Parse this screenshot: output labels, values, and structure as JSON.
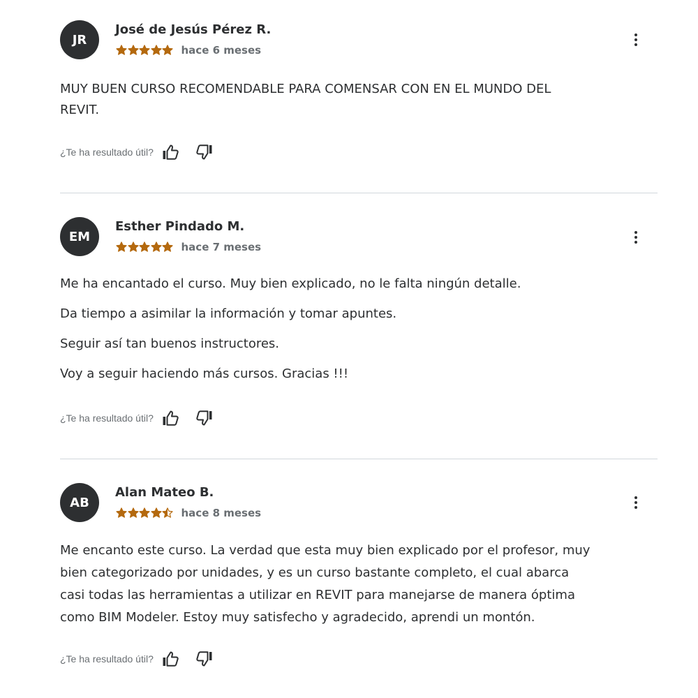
{
  "helpful_label": "¿Te ha resultado útil?",
  "colors": {
    "star": "#b4690e",
    "avatar_bg": "#2d2f31",
    "text": "#2d2f31",
    "muted": "#6a6f73",
    "divider": "#d1d7dc"
  },
  "reviews": [
    {
      "initials": "JR",
      "name": "José de Jesús Pérez R.",
      "rating": 5,
      "time": "hace 6 meses",
      "lines": [
        "MUY BUEN CURSO RECOMENDABLE PARA COMENSAR CON EN EL MUNDO DEL",
        "REVIT."
      ]
    },
    {
      "initials": "EM",
      "name": "Esther Pindado M.",
      "rating": 5,
      "time": "hace 7 meses",
      "paragraphs": [
        "Me ha encantado el curso. Muy bien explicado, no le falta ningún detalle.",
        "Da tiempo a asimilar la información y tomar apuntes.",
        "Seguir así tan buenos instructores.",
        "Voy a seguir haciendo más cursos. Gracias !!!"
      ]
    },
    {
      "initials": "AB",
      "name": "Alan Mateo B.",
      "rating": 4.5,
      "time": "hace 8 meses",
      "lines": [
        "Me encanto este curso. La verdad que esta muy bien explicado por el profesor, muy",
        "bien categorizado por unidades, y es un curso bastante completo, el cual abarca",
        "casi todas las herramientas a utilizar en REVIT para manejarse de manera óptima",
        "como BIM Modeler. Estoy muy satisfecho y agradecido, aprendi un montón."
      ]
    }
  ]
}
